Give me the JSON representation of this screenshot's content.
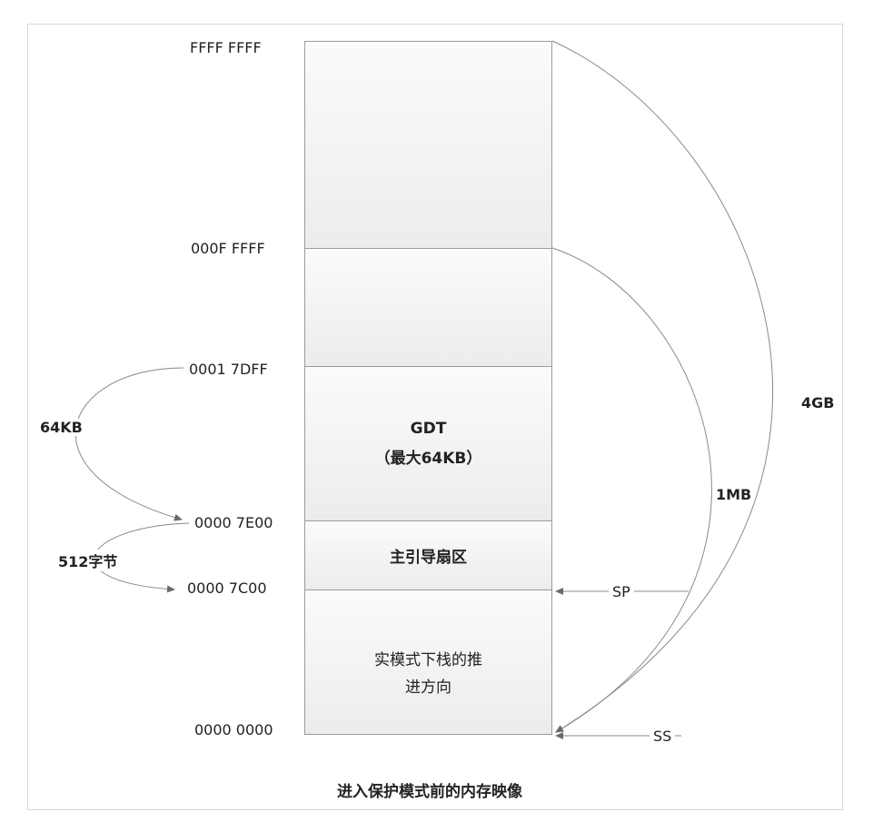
{
  "addresses": {
    "a0": "FFFF FFFF",
    "a1": "000F FFFF",
    "a2": "0001 7DFF",
    "a3": "0000 7E00",
    "a4": "0000 7C00",
    "a5": "0000 0000"
  },
  "blocks": {
    "gdt_line1": "GDT",
    "gdt_line2": "（最大64KB）",
    "boot": "主引导扇区",
    "stack_line1": "实模式下栈的推",
    "stack_line2": "进方向"
  },
  "spans": {
    "size_4gb": "4GB",
    "size_1mb": "1MB",
    "size_64kb": "64KB",
    "size_512": "512字节"
  },
  "registers": {
    "sp": "SP",
    "ss": "SS"
  },
  "caption": "进入保护模式前的内存映像"
}
